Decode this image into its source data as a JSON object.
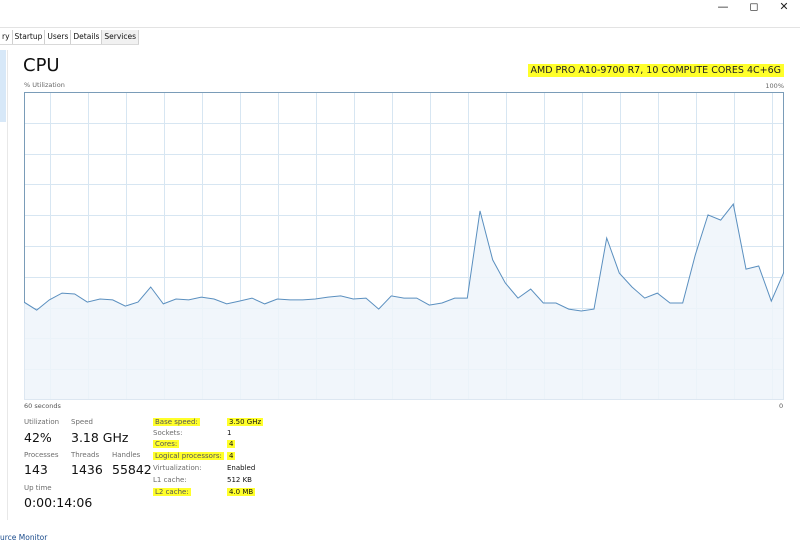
{
  "window": {
    "controls": {
      "minimize": "—",
      "maximize": "◻",
      "close": "✕"
    }
  },
  "tabs": [
    {
      "label": "ry"
    },
    {
      "label": "Startup"
    },
    {
      "label": "Users"
    },
    {
      "label": "Details"
    },
    {
      "label": "Services"
    }
  ],
  "header": {
    "title": "CPU",
    "model": "AMD PRO A10-9700 R7, 10 COMPUTE CORES 4C+6G",
    "y_label": "% Utilization",
    "y_max_label": "100%",
    "x_label": "60 seconds",
    "x_min_label": "0"
  },
  "colors": {
    "line": "#5a8fbf",
    "fill": "#eef4fa",
    "grid": "#d7e6f2",
    "border": "#7a9cb8",
    "highlight": "#ffff2a"
  },
  "stats": {
    "utilization": {
      "label": "Utilization",
      "value": "42%"
    },
    "speed": {
      "label": "Speed",
      "value": "3.18 GHz"
    },
    "processes": {
      "label": "Processes",
      "value": "143"
    },
    "threads": {
      "label": "Threads",
      "value": "1436"
    },
    "handles": {
      "label": "Handles",
      "value": "55842"
    },
    "uptime": {
      "label": "Up time",
      "value": "0:00:14:06"
    }
  },
  "specs": [
    {
      "label": "Base speed:",
      "value": "3.50 GHz",
      "highlight": true
    },
    {
      "label": "Sockets:",
      "value": "1",
      "highlight": false
    },
    {
      "label": "Cores:",
      "value": "4",
      "highlight": true
    },
    {
      "label": "Logical processors:",
      "value": "4",
      "highlight": true
    },
    {
      "label": "Virtualization:",
      "value": "Enabled",
      "highlight": false
    },
    {
      "label": "L1 cache:",
      "value": "512 KB",
      "highlight": false
    },
    {
      "label": "L2 cache:",
      "value": "4.0 MB",
      "highlight": true
    }
  ],
  "footer": {
    "link": "urce Monitor"
  },
  "chart_data": {
    "type": "area",
    "title": "CPU % Utilization",
    "xlabel": "60 seconds",
    "ylabel": "% Utilization",
    "xlim": [
      60,
      0
    ],
    "ylim": [
      0,
      100
    ],
    "grid": true,
    "values": [
      31.8,
      29.2,
      32.5,
      34.7,
      34.4,
      31.8,
      32.8,
      32.5,
      30.5,
      31.8,
      36.7,
      31.2,
      32.8,
      32.5,
      33.4,
      32.8,
      31.2,
      32.1,
      33.1,
      31.2,
      32.8,
      32.5,
      32.5,
      32.8,
      33.4,
      33.8,
      32.8,
      33.1,
      29.5,
      33.8,
      33.1,
      33.1,
      30.8,
      31.5,
      33.1,
      33.1,
      61.4,
      45.5,
      38.0,
      33.1,
      36.0,
      31.5,
      31.5,
      29.5,
      28.9,
      29.5,
      52.6,
      41.2,
      36.7,
      33.1,
      34.7,
      31.5,
      31.5,
      47.1,
      60.1,
      58.4,
      63.6,
      42.5,
      43.5,
      32.1,
      41.6
    ]
  }
}
